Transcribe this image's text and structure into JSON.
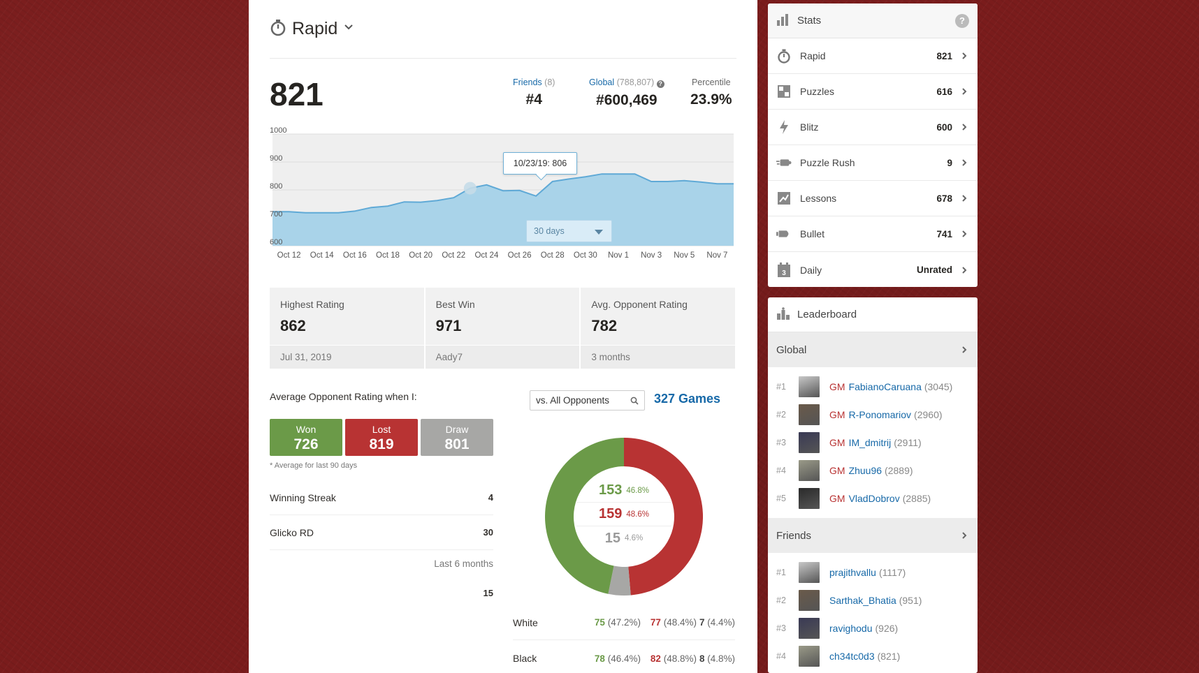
{
  "header": {
    "title": "Rapid"
  },
  "rating": {
    "current": "821"
  },
  "ranks": [
    {
      "label": "Friends",
      "extra": "(8)",
      "value": "#4"
    },
    {
      "label": "Global",
      "extra": "(788,807)",
      "value": "#600,469"
    },
    {
      "label": "Percentile",
      "extra": "",
      "value": "23.9%"
    }
  ],
  "chart": {
    "tooltip": "10/23/19: 806",
    "range_select": "30 days",
    "y_ticks": [
      "1000",
      "900",
      "800",
      "700",
      "600"
    ],
    "x_ticks": [
      "Oct 12",
      "Oct 14",
      "Oct 16",
      "Oct 18",
      "Oct 20",
      "Oct 22",
      "Oct 24",
      "Oct 26",
      "Oct 28",
      "Oct 30",
      "Nov 1",
      "Nov 3",
      "Nov 5",
      "Nov 7"
    ]
  },
  "chart_data": {
    "type": "area",
    "ylim": [
      600,
      1000
    ],
    "x": [
      "Oct 11",
      "Oct 12",
      "Oct 13",
      "Oct 14",
      "Oct 15",
      "Oct 16",
      "Oct 17",
      "Oct 18",
      "Oct 19",
      "Oct 20",
      "Oct 21",
      "Oct 22",
      "Oct 23",
      "Oct 24",
      "Oct 25",
      "Oct 26",
      "Oct 27",
      "Oct 28",
      "Oct 29",
      "Oct 30",
      "Oct 31",
      "Nov 1",
      "Nov 2",
      "Nov 3",
      "Nov 4",
      "Nov 5",
      "Nov 6",
      "Nov 7",
      "Nov 8"
    ],
    "values": [
      722,
      722,
      718,
      718,
      718,
      724,
      737,
      742,
      757,
      756,
      762,
      772,
      806,
      818,
      797,
      798,
      778,
      830,
      839,
      847,
      857,
      857,
      857,
      830,
      830,
      833,
      828,
      822,
      822
    ],
    "highlight": {
      "date": "10/23/19",
      "value": 806
    }
  },
  "summary": [
    {
      "label": "Highest Rating",
      "value": "862",
      "sub": "Jul 31, 2019"
    },
    {
      "label": "Best Win",
      "value": "971",
      "sub": "Aady7"
    },
    {
      "label": "Avg. Opponent Rating",
      "value": "782",
      "sub": "3 months"
    }
  ],
  "opponents": {
    "label": "Average Opponent Rating when I:",
    "won_label": "Won",
    "won": "726",
    "lost_label": "Lost",
    "lost": "819",
    "draw_label": "Draw",
    "draw": "801",
    "footnote": "* Average for last 90 days",
    "streak_label": "Winning Streak",
    "streak": "4",
    "glicko_label": "Glicko RD",
    "glicko": "30",
    "last6_label": "Last 6 months",
    "last6": "15"
  },
  "games": {
    "filter": "vs. All Opponents",
    "total": "327 Games",
    "won": "153",
    "won_pct": "46.8%",
    "lost": "159",
    "lost_pct": "48.6%",
    "draw": "15",
    "draw_pct": "4.6%",
    "colors": {
      "won": "#6b9a48",
      "lost": "#b83333",
      "draw": "#a7a7a5"
    },
    "white": {
      "label": "White",
      "w": "75",
      "wp": "(47.2%)",
      "l": "77",
      "lp": "(48.4%)",
      "d": "7",
      "dp": "(4.4%)"
    },
    "black": {
      "label": "Black",
      "w": "78",
      "wp": "(46.4%)",
      "l": "82",
      "lp": "(48.8%)",
      "d": "8",
      "dp": "(4.8%)"
    }
  },
  "stats": {
    "title": "Stats",
    "help": "?",
    "items": [
      {
        "label": "Rapid",
        "value": "821",
        "icon": "stopwatch-icon"
      },
      {
        "label": "Puzzles",
        "value": "616",
        "icon": "puzzle-icon"
      },
      {
        "label": "Blitz",
        "value": "600",
        "icon": "lightning-icon"
      },
      {
        "label": "Puzzle Rush",
        "value": "9",
        "icon": "puzzle-rush-icon"
      },
      {
        "label": "Lessons",
        "value": "678",
        "icon": "lessons-icon"
      },
      {
        "label": "Bullet",
        "value": "741",
        "icon": "bullet-icon"
      },
      {
        "label": "Daily",
        "value": "Unrated",
        "icon": "calendar-icon"
      }
    ]
  },
  "leaderboard": {
    "title": "Leaderboard",
    "global_label": "Global",
    "global": [
      {
        "rank": "#1",
        "title": "GM",
        "name": "FabianoCaruana",
        "rating": "(3045)"
      },
      {
        "rank": "#2",
        "title": "GM",
        "name": "R-Ponomariov",
        "rating": "(2960)"
      },
      {
        "rank": "#3",
        "title": "GM",
        "name": "IM_dmitrij",
        "rating": "(2911)"
      },
      {
        "rank": "#4",
        "title": "GM",
        "name": "Zhuu96",
        "rating": "(2889)"
      },
      {
        "rank": "#5",
        "title": "GM",
        "name": "VladDobrov",
        "rating": "(2885)"
      }
    ],
    "friends_label": "Friends",
    "friends": [
      {
        "rank": "#1",
        "name": "prajithvallu",
        "rating": "(1117)"
      },
      {
        "rank": "#2",
        "name": "Sarthak_Bhatia",
        "rating": "(951)"
      },
      {
        "rank": "#3",
        "name": "ravighodu",
        "rating": "(926)"
      },
      {
        "rank": "#4",
        "name": "ch34tc0d3",
        "rating": "(821)"
      }
    ]
  }
}
